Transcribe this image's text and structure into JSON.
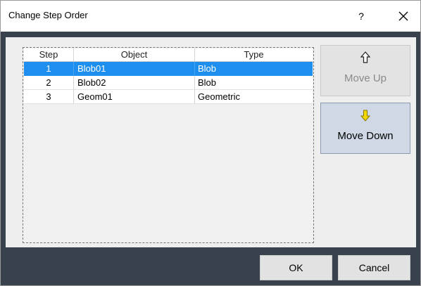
{
  "window": {
    "title": "Change Step Order",
    "help_label": "?"
  },
  "table": {
    "columns": [
      "Step",
      "Object",
      "Type"
    ],
    "rows": [
      {
        "step": "1",
        "object": "Blob01",
        "type": "Blob",
        "selected": true
      },
      {
        "step": "2",
        "object": "Blob02",
        "type": "Blob",
        "selected": false
      },
      {
        "step": "3",
        "object": "Geom01",
        "type": "Geometric",
        "selected": false
      }
    ]
  },
  "side_buttons": {
    "move_up": {
      "label": "Move Up",
      "icon": "arrow-up-outline-icon",
      "enabled": false
    },
    "move_down": {
      "label": "Move Down",
      "icon": "arrow-down-yellow-icon",
      "enabled": true
    }
  },
  "footer": {
    "ok_label": "OK",
    "cancel_label": "Cancel"
  },
  "colors": {
    "selection": "#1f8fef",
    "frame": "#39424c",
    "move_down_arrow": "#f0d800"
  }
}
